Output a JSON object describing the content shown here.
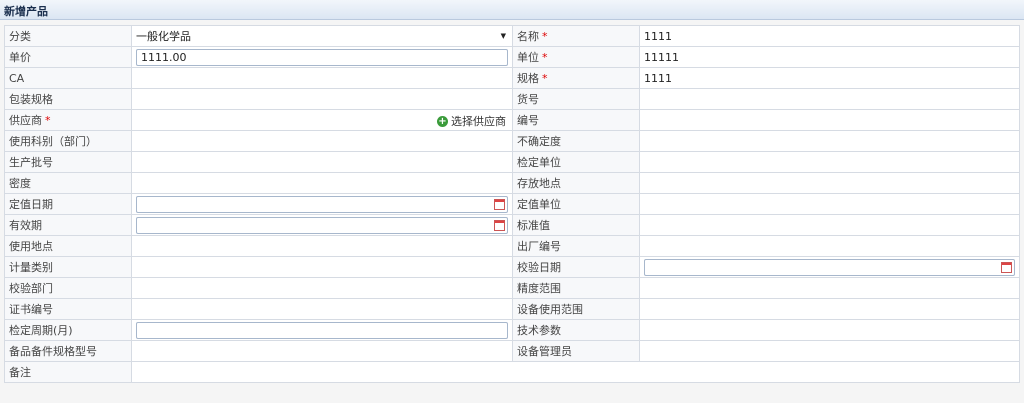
{
  "header": {
    "title": "新增产品"
  },
  "form": {
    "category_label": "分类",
    "category_value": "一般化学品",
    "name_label": "名称",
    "name_value": "1111",
    "price_label": "单价",
    "price_value": "1111.00",
    "unit_label": "单位",
    "unit_value": "11111",
    "cas_label": "CA",
    "spec_label": "规格",
    "spec_value": "1111",
    "package_spec_label": "包装规格",
    "item_no_label": "货号",
    "supplier_label": "供应商",
    "select_supplier_label": "选择供应商",
    "code_label": "编号",
    "usage_category_label": "使用科别（部门）",
    "uncertainty_label": "不确定度",
    "batch_no_label": "生产批号",
    "calibration_unit_label": "检定单位",
    "density_label": "密度",
    "storage_location_label": "存放地点",
    "valuation_date_label": "定值日期",
    "valuation_unit_label": "定值单位",
    "expiry_label": "有效期",
    "standard_value_label": "标准值",
    "usage_location_label": "使用地点",
    "factory_no_label": "出厂编号",
    "metrology_type_label": "计量类别",
    "calibration_date_label": "校验日期",
    "calibration_dept_label": "校验部门",
    "accuracy_range_label": "精度范围",
    "certificate_no_label": "证书编号",
    "equipment_scope_label": "设备使用范围",
    "calibration_period_label": "检定周期(月)",
    "tech_params_label": "技术参数",
    "spare_parts_label": "备品备件规格型号",
    "equipment_manager_label": "设备管理员",
    "remarks_label": "备注",
    "required_mark": "*"
  },
  "icons": {
    "dropdown": "chevron-down-icon",
    "calendar": "calendar-icon",
    "add": "plus-circle-icon"
  },
  "colors": {
    "required": "#dd0000",
    "add_icon": "#3a9b3a"
  }
}
